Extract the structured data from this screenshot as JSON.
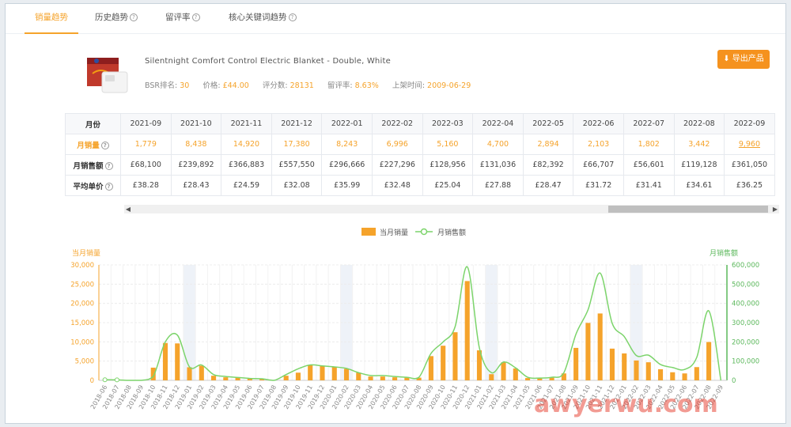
{
  "tabs": [
    {
      "label": "销量趋势",
      "active": true
    },
    {
      "label": "历史趋势",
      "help": true
    },
    {
      "label": "留评率",
      "help": true
    },
    {
      "label": "核心关键词趋势",
      "help": true
    }
  ],
  "product": {
    "title": "Silentnight Comfort Control Electric Blanket - Double, White",
    "bsr_label": "BSR排名:",
    "bsr": "30",
    "price_label": "价格:",
    "price": "£44.00",
    "rating_label": "评分数:",
    "rating": "28131",
    "review_rate_label": "留评率:",
    "review_rate": "8.63%",
    "date_label": "上架时间:",
    "date": "2009-06-29"
  },
  "export_label": "导出产品",
  "table": {
    "header_label": "月份",
    "months": [
      "2021-09",
      "2021-10",
      "2021-11",
      "2021-12",
      "2022-01",
      "2022-02",
      "2022-03",
      "2022-04",
      "2022-05",
      "2022-06",
      "2022-07",
      "2022-08",
      "2022-09"
    ],
    "rows": [
      {
        "label": "月销量",
        "help": true,
        "values": [
          "1,779",
          "8,438",
          "14,920",
          "17,380",
          "8,243",
          "6,996",
          "5,160",
          "4,700",
          "2,894",
          "2,103",
          "1,802",
          "3,442",
          "9,960"
        ]
      },
      {
        "label": "月销售额",
        "help": true,
        "values": [
          "£68,100",
          "£239,892",
          "£366,883",
          "£557,550",
          "£296,666",
          "£227,296",
          "£128,956",
          "£131,036",
          "£82,392",
          "£66,707",
          "£56,601",
          "£119,128",
          "£361,050"
        ]
      },
      {
        "label": "平均单价",
        "help": true,
        "values": [
          "£38.28",
          "£28.43",
          "£24.59",
          "£32.08",
          "£35.99",
          "£32.48",
          "£25.04",
          "£27.88",
          "£28.47",
          "£31.72",
          "£31.41",
          "£34.61",
          "£36.25"
        ]
      }
    ]
  },
  "chart_data": {
    "type": "bar",
    "legend": [
      "当月销量",
      "月销售额"
    ],
    "left_axis_title": "当月销量",
    "right_axis_title": "月销售额",
    "left_ylim": [
      0,
      30000
    ],
    "left_ticks": [
      "0",
      "5,000",
      "10,000",
      "15,000",
      "20,000",
      "25,000",
      "30,000"
    ],
    "right_ylim": [
      0,
      600000
    ],
    "right_ticks": [
      "0",
      "100,000",
      "200,000",
      "300,000",
      "400,000",
      "500,000",
      "600,000"
    ],
    "categories": [
      "2018-06",
      "2018-07",
      "2018-08",
      "2018-09",
      "2018-10",
      "2018-11",
      "2018-12",
      "2019-01",
      "2019-02",
      "2019-03",
      "2019-04",
      "2019-05",
      "2019-06",
      "2019-07",
      "2019-08",
      "2019-09",
      "2019-10",
      "2019-11",
      "2019-12",
      "2020-01",
      "2020-02",
      "2020-03",
      "2020-04",
      "2020-05",
      "2020-06",
      "2020-07",
      "2020-08",
      "2020-09",
      "2020-10",
      "2020-11",
      "2020-12",
      "2021-01",
      "2021-02",
      "2021-03",
      "2021-04",
      "2021-05",
      "2021-06",
      "2021-07",
      "2021-08",
      "2021-09",
      "2021-10",
      "2021-11",
      "2021-12",
      "2022-01",
      "2022-02",
      "2022-03",
      "2022-04",
      "2022-05",
      "2022-06",
      "2022-07",
      "2022-08",
      "2022-09"
    ],
    "visible_tick_labels": [
      "2018-06",
      "2018-07",
      "2018-08",
      "2018-09",
      "2018-10",
      "2018-11",
      "2018-12",
      "2019-01",
      "2019-02",
      "2019-03",
      "2019-04",
      "2019-05",
      "2019-06",
      "2019-07",
      "2019-08",
      "2019-09",
      "2019-10",
      "2019-11",
      "2019-12",
      "2020-01",
      "2020-02",
      "2020-03",
      "2020-04",
      "2020-05",
      "2020-06",
      "2020-07",
      "2020-08",
      "2020-09",
      "2020-10",
      "2020-11",
      "2020-12",
      "2021-01",
      "2021-02",
      "2021-03",
      "2021-04",
      "2021-05",
      "2021-06",
      "2021-07",
      "2021-08",
      "2021-09",
      "2021-10",
      "2021-11",
      "2021-12",
      "2022-01",
      "2022-02",
      "2022-03",
      "2022-04",
      "2022-05",
      "2022-06",
      "2022-07",
      "2022-08",
      "2022-09"
    ],
    "series": [
      {
        "name": "当月销量",
        "values": [
          0,
          0,
          0,
          0,
          3300,
          9700,
          9600,
          3400,
          3800,
          1200,
          800,
          700,
          500,
          400,
          0,
          1200,
          2000,
          4000,
          3700,
          3500,
          3000,
          2000,
          1000,
          1000,
          800,
          700,
          700,
          6300,
          9000,
          12500,
          25800,
          7800,
          1600,
          4700,
          3100,
          600,
          500,
          700,
          1800,
          8438,
          14920,
          17380,
          8243,
          6996,
          5160,
          4700,
          2894,
          2103,
          1802,
          3442,
          9960,
          0
        ],
        "color": "#f5a32b"
      },
      {
        "name": "月销售额",
        "values": [
          3000,
          2500,
          0,
          0,
          20000,
          200000,
          235000,
          70000,
          80000,
          30000,
          20000,
          15000,
          10000,
          8000,
          0,
          30000,
          60000,
          80000,
          75000,
          70000,
          62000,
          40000,
          25000,
          25000,
          20000,
          16000,
          16000,
          140000,
          200000,
          280000,
          590000,
          170000,
          40000,
          95000,
          65000,
          16000,
          12000,
          16000,
          40000,
          239892,
          366883,
          557550,
          296666,
          227296,
          128956,
          131036,
          82392,
          66707,
          56601,
          119128,
          361050,
          0
        ],
        "color": "#7cd46b"
      }
    ],
    "highlight_last_bar_color": "#7b8fe8",
    "grid": true,
    "legend_position": "top-center"
  },
  "watermark": "awyerwu.com"
}
